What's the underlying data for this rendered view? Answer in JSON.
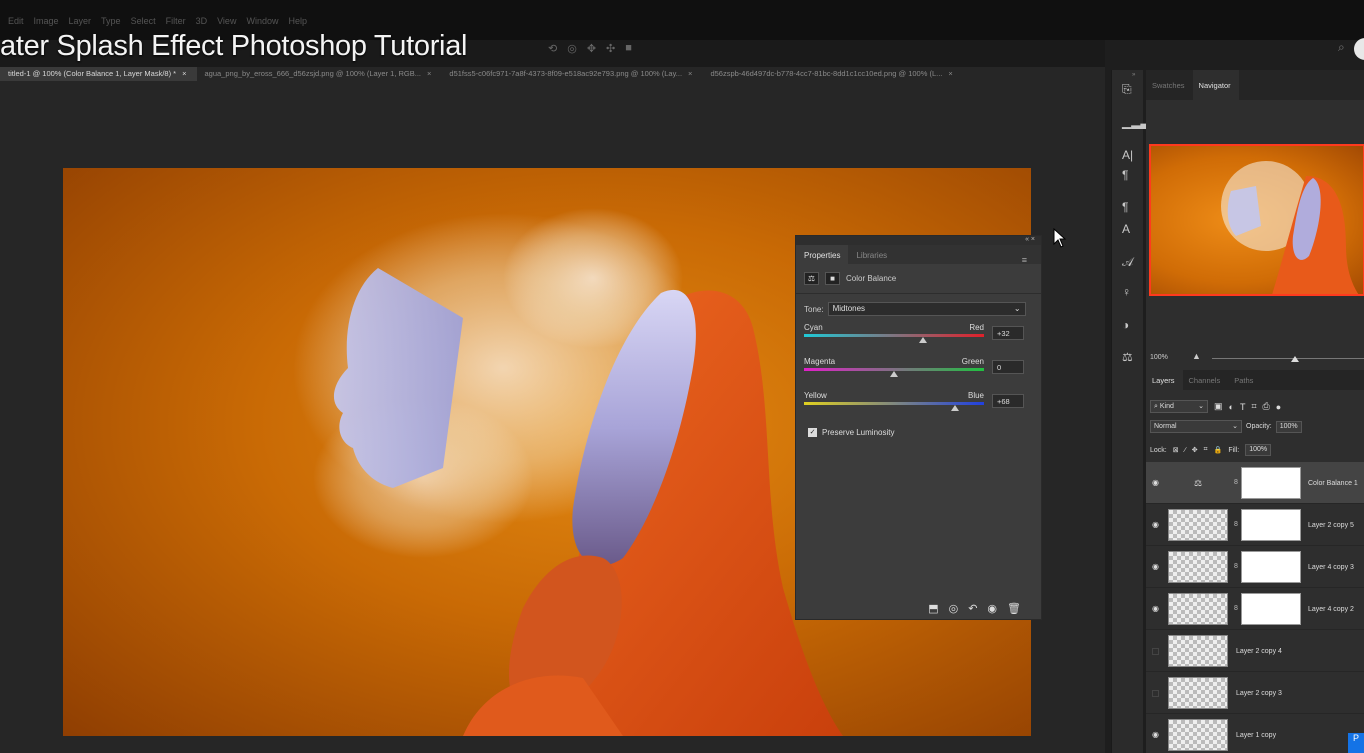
{
  "menubar": {
    "items": [
      "Edit",
      "Image",
      "Layer",
      "Type",
      "Select",
      "Filter",
      "3D",
      "View",
      "Window",
      "Help"
    ]
  },
  "video_title": "ater Splash Effect Photoshop Tutorial",
  "tabs": [
    {
      "label": "titled-1 @ 100% (Color Balance 1, Layer Mask/8) *",
      "active": true
    },
    {
      "label": "agua_png_by_eross_666_d56zsjd.png @ 100% (Layer 1, RGB...",
      "active": false
    },
    {
      "label": "d51fss5-c06fc971-7a8f-4373-8f09-e518ac92e793.png @ 100% (Lay...",
      "active": false
    },
    {
      "label": "d56zspb-46d497dc-b778-4cc7-81bc-8dd1c1cc10ed.png @ 100% (L...",
      "active": false
    }
  ],
  "tab_close": "×",
  "properties_panel": {
    "tabs": [
      "Properties",
      "Libraries"
    ],
    "adjustment_name": "Color Balance",
    "tone_label": "Tone:",
    "tone_value": "Midtones",
    "sliders": [
      {
        "left": "Cyan",
        "right": "Red",
        "value": "+32",
        "level": 0.66,
        "colors": [
          "#1fc9d6",
          "#e0202a"
        ]
      },
      {
        "left": "Magenta",
        "right": "Green",
        "value": "0",
        "level": 0.5,
        "colors": [
          "#e020c8",
          "#20c040"
        ]
      },
      {
        "left": "Yellow",
        "right": "Blue",
        "value": "+68",
        "level": 0.84,
        "colors": [
          "#e0d020",
          "#2040e0"
        ]
      }
    ],
    "preserve_luminosity": "Preserve Luminosity",
    "footer_icons": [
      "clip-icon",
      "view-previous-icon",
      "reset-icon",
      "visibility-icon",
      "delete-icon"
    ]
  },
  "navigator": {
    "tabs": [
      "Swatches",
      "Navigator"
    ],
    "zoom": "100%"
  },
  "layers_panel": {
    "tabs": [
      "Layers",
      "Channels",
      "Paths"
    ],
    "kind": "Kind",
    "blend_mode": "Normal",
    "opacity_label": "Opacity:",
    "opacity_value": "100%",
    "lock_label": "Lock:",
    "fill_label": "Fill:",
    "fill_value": "100%",
    "layers": [
      {
        "name": "Color Balance 1",
        "visible": true,
        "type": "adjustment",
        "active": true
      },
      {
        "name": "Layer 2 copy 5",
        "visible": true,
        "type": "masked"
      },
      {
        "name": "Layer 4 copy 3",
        "visible": true,
        "type": "masked"
      },
      {
        "name": "Layer 4 copy 2",
        "visible": true,
        "type": "masked"
      },
      {
        "name": "Layer 2 copy 4",
        "visible": false,
        "type": "pixel"
      },
      {
        "name": "Layer 2 copy 3",
        "visible": false,
        "type": "pixel"
      },
      {
        "name": "Layer 1 copy",
        "visible": true,
        "type": "pixel"
      }
    ]
  },
  "colors": {
    "accent_highlight": "#ff3a1e",
    "canvas_orange": "#d8780c",
    "hoodie_orange": "#e8571a"
  }
}
